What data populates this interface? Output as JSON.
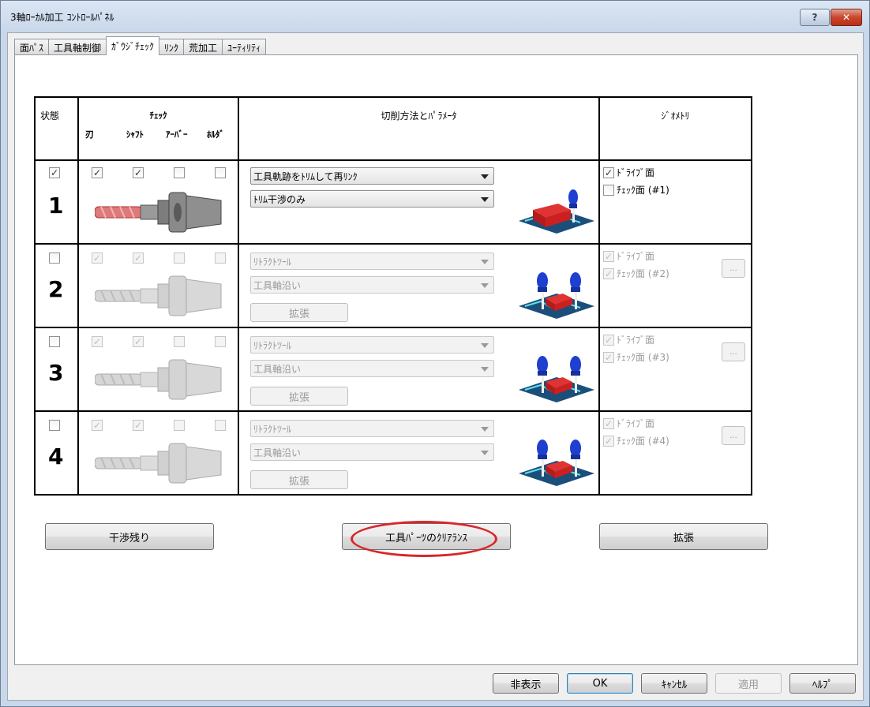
{
  "window": {
    "title": "3軸ﾛｰｶﾙ加工 ｺﾝﾄﾛｰﾙﾊﾟﾈﾙ",
    "help_label": "?",
    "close_label": "✕"
  },
  "tabs": [
    "面ﾊﾟｽ",
    "工具軸制御",
    "ｶﾞｳｼﾞﾁｪｯｸ",
    "ﾘﾝｸ",
    "荒加工",
    "ﾕｰﾃｨﾘﾃｨ"
  ],
  "active_tab": "ｶﾞｳｼﾞﾁｪｯｸ",
  "table": {
    "headers": {
      "status": "状態",
      "check": "ﾁｪｯｸ",
      "check_sub": [
        "刃",
        "ｼｬﾌﾄ",
        "ｱｰﾊﾞｰ",
        "ﾎﾙﾀﾞ"
      ],
      "method": "切削方法とﾊﾟﾗﾒｰﾀ",
      "geometry": "ｼﾞｵﾒﾄﾘ"
    },
    "rows": [
      {
        "num": "1",
        "status": true,
        "blade": true,
        "shaft": true,
        "arbor": false,
        "holder": false,
        "method": "工具軌跡をﾄﾘﾑして再ﾘﾝｸ",
        "param": "ﾄﾘﾑ干渉のみ",
        "expand": "",
        "drive": "ﾄﾞﾗｲﾌﾞ面",
        "check_face": "ﾁｪｯｸ面 (#1)"
      },
      {
        "num": "2",
        "status": false,
        "blade": true,
        "shaft": true,
        "arbor": false,
        "holder": false,
        "method": "ﾘﾄﾗｸﾄﾂｰﾙ",
        "param": "工具軸沿い",
        "expand": "拡張",
        "drive": "ﾄﾞﾗｲﾌﾞ面",
        "check_face": "ﾁｪｯｸ面 (#2)"
      },
      {
        "num": "3",
        "status": false,
        "blade": true,
        "shaft": true,
        "arbor": false,
        "holder": false,
        "method": "ﾘﾄﾗｸﾄﾂｰﾙ",
        "param": "工具軸沿い",
        "expand": "拡張",
        "drive": "ﾄﾞﾗｲﾌﾞ面",
        "check_face": "ﾁｪｯｸ面 (#3)"
      },
      {
        "num": "4",
        "status": false,
        "blade": true,
        "shaft": true,
        "arbor": false,
        "holder": false,
        "method": "ﾘﾄﾗｸﾄﾂｰﾙ",
        "param": "工具軸沿い",
        "expand": "拡張",
        "drive": "ﾄﾞﾗｲﾌﾞ面",
        "check_face": "ﾁｪｯｸ面 (#4)"
      }
    ],
    "dots_label": "..."
  },
  "actions": {
    "interference": "干渉残り",
    "clearance": "工具ﾊﾟｰﾂのｸﾘｱﾗﾝｽ",
    "expand": "拡張"
  },
  "footer": {
    "hide": "非表示",
    "ok": "OK",
    "cancel": "ｷｬﾝｾﾙ",
    "apply": "適用",
    "help": "ﾍﾙﾌﾟ"
  },
  "colors": {
    "highlight_oval": "#d9262a",
    "cutter_active": "#e07a7a",
    "block": "#d81f1f",
    "probe": "#1f3fd0"
  }
}
